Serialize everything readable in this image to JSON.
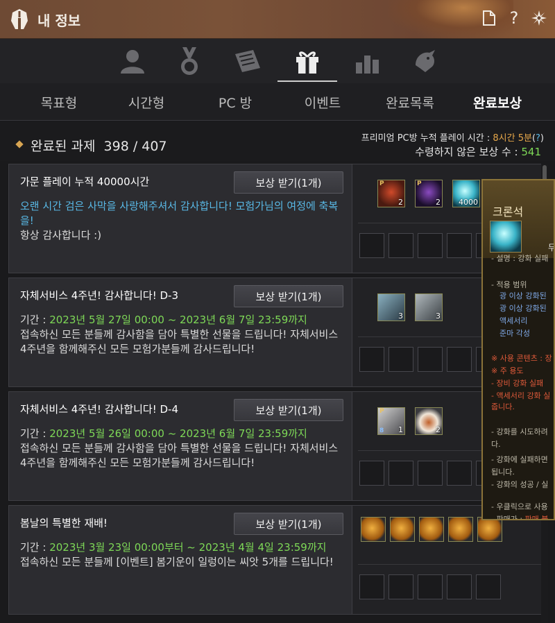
{
  "window": {
    "title": "내 정보"
  },
  "tabs": [
    {
      "label": "목표형"
    },
    {
      "label": "시간형"
    },
    {
      "label": "PC 방"
    },
    {
      "label": "이벤트"
    },
    {
      "label": "완료목록"
    },
    {
      "label": "완료보상"
    }
  ],
  "active_tab": "완료보상",
  "summary": {
    "completed_label": "완료된 과제",
    "completed_count": "398 / 407",
    "pc_time_label": "프리미엄 PC방 누적 플레이 시간 : ",
    "pc_time_value": "8시간 5분",
    "pc_time_open": "(",
    "pc_time_help": "?",
    "pc_time_close": ")",
    "unclaimed_label": "수령하지 않은 보상 수 : ",
    "unclaimed_value": "541"
  },
  "cards": [
    {
      "title": "가문 플레이 누적 40000시간",
      "button": "보상 받기(1개)",
      "line1": "오랜 시간 검은 사막을 사랑해주셔서 감사합니다! 모험가님의 여정에 축복을!",
      "line2": "항상 감사합니다 :)"
    },
    {
      "title": "자체서비스 4주년! 감사합니다! D-3",
      "button": "보상 받기(1개)",
      "period_label": "기간 : ",
      "period_value": "2023년 5월 27일 00:00 ~ 2023년 6월 7일 23:59까지",
      "desc": "접속하신 모든 분들께 감사함을 담아 특별한 선물을 드립니다! 자체서비스 4주년을 함께해주신 모든 모험가분들께 감사드립니다!"
    },
    {
      "title": "자체서비스 4주년! 감사합니다! D-4",
      "button": "보상 받기(1개)",
      "period_label": "기간 : ",
      "period_value": "2023년 5월 26일 00:00 ~ 2023년 6월 7일 23:59까지",
      "desc": "접속하신 모든 분들께 감사함을 담아 특별한 선물을 드립니다! 자체서비스 4주년을 함께해주신 모든 모험가분들께 감사드립니다!"
    },
    {
      "title": "봄날의 특별한 재배!",
      "button": "보상 받기(1개)",
      "period_label": "기간 : ",
      "period_value": "2023년 3월 23일 00:00부터 ~ 2023년 4월 4일 23:59까지",
      "desc": "접속하신 모든 분들께 [이벤트] 봄기운이 일렁이는 씨앗 5개를 드립니다!"
    }
  ],
  "rewards": [
    {
      "items": [
        {
          "icon": "costume-box-icon",
          "count": "2",
          "badge": "P"
        },
        {
          "icon": "dark-box-icon",
          "count": "2",
          "badge": "P"
        },
        {
          "icon": "cron-stone-icon",
          "count": "4000"
        }
      ]
    },
    {
      "items": [
        {
          "icon": "scroll-icon",
          "count": "3"
        },
        {
          "icon": "scroll-icon",
          "count": "3"
        }
      ]
    },
    {
      "items": [
        {
          "icon": "net-icon",
          "count": "1",
          "badge": "P",
          "level": "8"
        },
        {
          "icon": "tea-cup-icon",
          "count": "2"
        }
      ]
    },
    {
      "items": [
        {
          "icon": "seed-icon"
        },
        {
          "icon": "seed-icon"
        },
        {
          "icon": "seed-icon"
        },
        {
          "icon": "seed-icon"
        },
        {
          "icon": "seed-icon"
        }
      ]
    }
  ],
  "tooltip": {
    "name": "크론석",
    "right_partial": "무",
    "lines": [
      "- 설명 : 강화 실패",
      "- 적용 범위",
      "광 이상 강화된",
      "광 이상 강화된",
      "액세서리",
      "준마 각성",
      "※ 사용 콘텐츠 : 장",
      "※ 주 용도",
      "- 장비 강화 실패",
      "- 액세서리 강화 실",
      "줍니다.",
      "- 강화를 시도하려",
      "다.",
      "- 강화에 실패하면",
      "됩니다.",
      "- 강화의 성공 / 실",
      "- 우클릭으로 사용",
      "- 판매가 : ",
      "판매 불"
    ]
  },
  "colors": {
    "accent": "#e8a84a",
    "highlight_cyan": "#59b9e6",
    "highlight_green": "#7ed957"
  }
}
